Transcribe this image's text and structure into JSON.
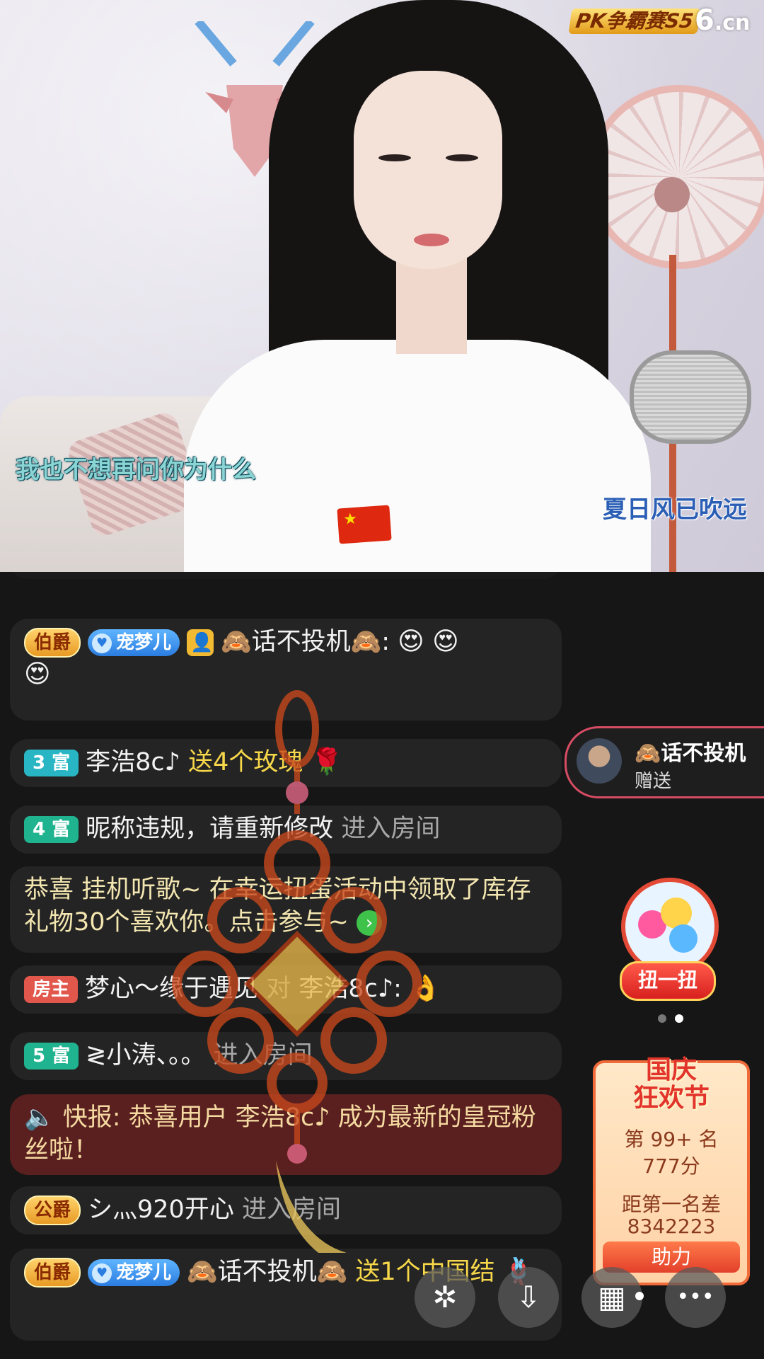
{
  "video": {
    "lyric_left": "我也不想再问你为什么",
    "lyric_right": "夏日风已吹远",
    "pk_logo": "PK争霸赛S5",
    "site_logo_num": "6",
    "site_logo_suffix": ".cn"
  },
  "chat": [
    {
      "badges": [
        "伯爵",
        "宠梦儿"
      ],
      "user": "🙈话不投机🙈:",
      "emojis": "😍 😍",
      "emoji_wrap": "😍"
    },
    {
      "badge": "3 富",
      "user": "李浩8c♪",
      "action": "送4个玫瑰",
      "gift_icon": "🌹"
    },
    {
      "badge": "4 富",
      "user": "昵称违规，请重新修改",
      "action": "进入房间"
    },
    {
      "text": "恭喜 挂机听歌~ 在幸运扭蛋活动中领取了库存礼物30个喜欢你。点击参与~",
      "arrow": "›"
    },
    {
      "badge": "房主",
      "user": "梦心～缘于遇见",
      "mid": "对",
      "target": "李浩8c♪:",
      "emoji": "👌"
    },
    {
      "badge": "5 富",
      "user": "≷小涛、。。",
      "action": "进入房间"
    },
    {
      "icon": "🔈",
      "text": "快报: 恭喜用户 李浩8c♪ 成为最新的皇冠粉丝啦！"
    },
    {
      "badge": "公爵",
      "user": "シ灬920开心",
      "action": "进入房间"
    },
    {
      "badges": [
        "伯爵",
        "宠梦儿"
      ],
      "user": "🙈话不投机🙈",
      "action": "送1个中国结",
      "gift_icon": "🪢"
    }
  ],
  "gift_toast": {
    "name": "🙈话不投机",
    "sub": "赠送"
  },
  "gacha": {
    "label": "扭一扭"
  },
  "festival": {
    "title_line1": "国庆",
    "title_line2": "狂欢节",
    "rank": "第 99+ 名",
    "score": "777分",
    "gap_label": "距第一名差",
    "gap_value": "8342223",
    "button": "助力"
  },
  "toolbar": {
    "share_icon": "✲",
    "download_icon": "⇩",
    "grid_icon": "▦",
    "more_icon": "•••"
  }
}
